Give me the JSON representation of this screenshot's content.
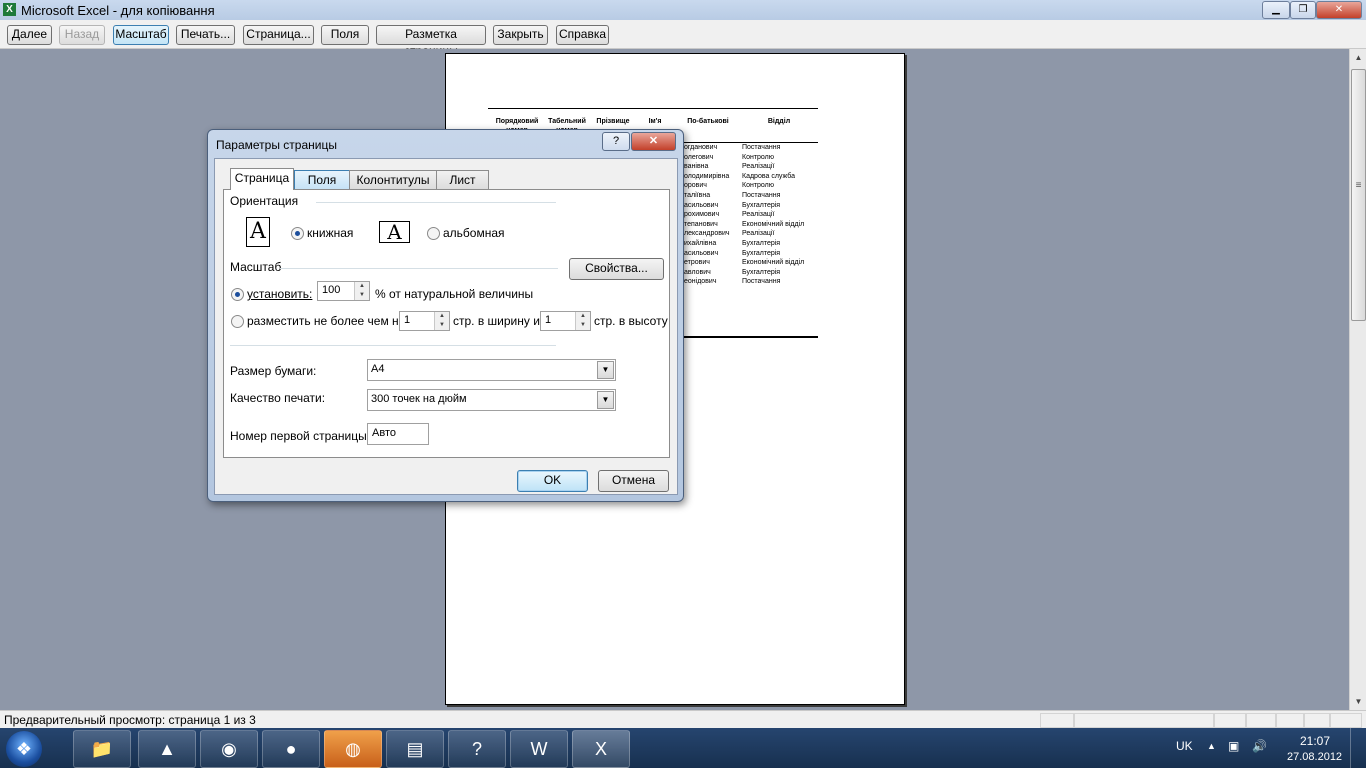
{
  "window": {
    "title": "Microsoft Excel - для копіювання",
    "app_icon": "X",
    "minimize_icon": "▁",
    "restore_icon": "❐",
    "close_icon": "✕"
  },
  "toolbar": {
    "next": "Далее",
    "back": "Назад",
    "zoom": "Масштаб",
    "print": "Печать...",
    "setup": "Страница...",
    "margins": "Поля",
    "page_break": "Разметка страницы",
    "close": "Закрыть",
    "help": "Справка"
  },
  "page_table": {
    "headers": [
      "Порядковий номер",
      "Табельний номер",
      "Прізвище",
      "Ім'я",
      "По-батькові",
      "Відділ"
    ],
    "rows": [
      [
        "огданович",
        "Постачання"
      ],
      [
        "олегович",
        "Контролю"
      ],
      [
        "ванівна",
        "Реалізації"
      ],
      [
        "олодимирівна",
        "Кадрова служба"
      ],
      [
        "орович",
        "Контролю"
      ],
      [
        "таліївна",
        "Постачання"
      ],
      [
        "асильович",
        "Бухгалтерія"
      ],
      [
        "рохимович",
        "Реалізації"
      ],
      [
        "тепанович",
        "Економічний відділ"
      ],
      [
        "лександрович",
        "Реалізації"
      ],
      [
        "ихайлівна",
        "Бухгалтерія"
      ],
      [
        "асильович",
        "Бухгалтерія"
      ],
      [
        "етрович",
        "Економічний відділ"
      ],
      [
        "авлович",
        "Бухгалтерія"
      ],
      [
        "еонідович",
        "Постачання"
      ]
    ]
  },
  "dialog": {
    "title": "Параметры страницы",
    "help_icon": "?",
    "close_icon": "✕",
    "tabs": [
      "Страница",
      "Поля",
      "Колонтитулы",
      "Лист"
    ],
    "orientation": {
      "heading": "Ориентация",
      "icon_letter": "A",
      "portrait": "книжная",
      "landscape": "альбомная",
      "selected": "portrait"
    },
    "scale": {
      "heading": "Масштаб",
      "properties_button": "Свойства...",
      "adjust_label": "установить:",
      "adjust_value": "100",
      "adjust_suffix": "% от натуральной величины",
      "fit_label": "разместить не более чем на:",
      "fit_wide_value": "1",
      "fit_wide_suffix": "стр. в ширину и",
      "fit_tall_value": "1",
      "fit_tall_suffix": "стр. в высоту",
      "selected": "adjust"
    },
    "paper_size_label": "Размер бумаги:",
    "paper_size_value": "A4",
    "print_quality_label": "Качество печати:",
    "print_quality_value": "300 точек на дюйм",
    "first_page_label": "Номер первой страницы:",
    "first_page_value": "Авто",
    "ok": "OK",
    "cancel": "Отмена",
    "spin_up": "▲",
    "spin_down": "▼",
    "dropdown_arrow": "▼"
  },
  "statusbar": {
    "text": "Предварительный просмотр: страница 1 из 3"
  },
  "scrollbar": {
    "up_arrow": "▲",
    "down_arrow": "▼",
    "grip": "≡"
  },
  "taskbar": {
    "start_icon": "❖",
    "apps": [
      {
        "name": "explorer",
        "glyph": "📁"
      },
      {
        "name": "aimp",
        "glyph": "▲"
      },
      {
        "name": "chrome",
        "glyph": "◉"
      },
      {
        "name": "paint",
        "glyph": "●"
      },
      {
        "name": "firefox",
        "glyph": "◍"
      },
      {
        "name": "winrar",
        "glyph": "▤"
      },
      {
        "name": "help",
        "glyph": "?"
      },
      {
        "name": "word",
        "glyph": "W"
      },
      {
        "name": "excel",
        "glyph": "X"
      }
    ],
    "language": "UK",
    "tray_arrow": "▲",
    "network_icon": "▣",
    "volume_icon": "🔊",
    "time": "21:07",
    "date": "27.08.2012"
  },
  "colors": {
    "accent": "#3c7fb1",
    "preview_bg": "#8e97a8",
    "taskbar": "#1e3b62"
  }
}
